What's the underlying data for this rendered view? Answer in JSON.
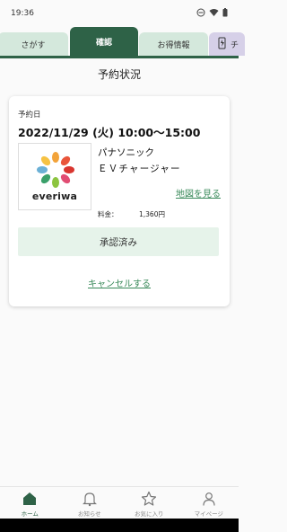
{
  "status_bar": {
    "time": "19:36"
  },
  "tabs": {
    "search": "さがす",
    "confirm": "確認",
    "deals": "お得情報",
    "ev_partial": "チ"
  },
  "page": {
    "title": "予約状況"
  },
  "reservation": {
    "date_label": "予約日",
    "date_value": "2022/11/29 (火) 10:00〜15:00",
    "logo_text": "everiwa",
    "shop_name": "パナソニック",
    "shop_sub": "ＥＶチャージャー",
    "map_link": "地図を見る",
    "price_label": "料金：",
    "price_value": "1,360円",
    "status_label": "承認済み",
    "cancel_label": "キャンセルする"
  },
  "bottom_nav": {
    "home": "ホーム",
    "notifications": "お知らせ",
    "favorites": "お気に入り",
    "mypage": "マイページ"
  },
  "colors": {
    "primary_green": "#2e6247",
    "link_green": "#3a8a5a",
    "tab_inactive": "#d4e8dc",
    "approved_bg": "#e6f3ea"
  }
}
